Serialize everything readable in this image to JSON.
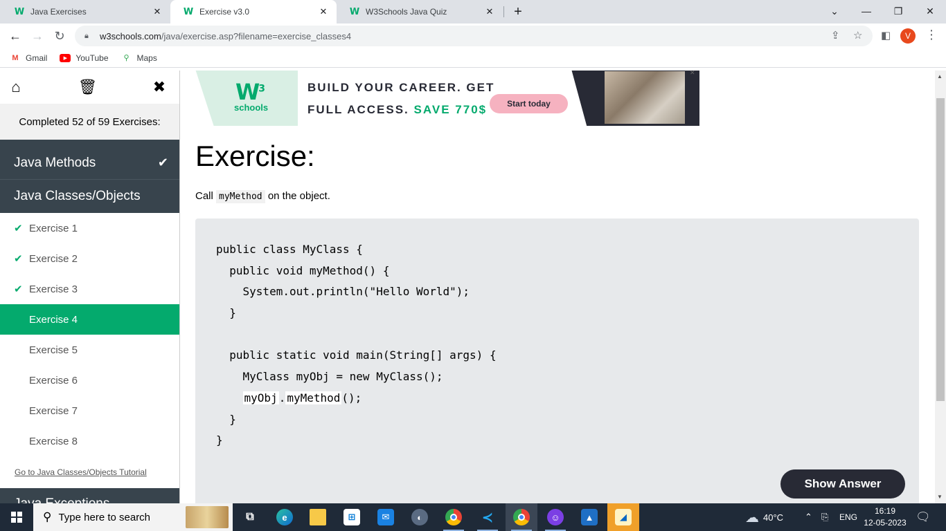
{
  "browser": {
    "tabs": [
      {
        "label": "Java Exercises",
        "favicon": "W",
        "active": false
      },
      {
        "label": "Exercise v3.0",
        "favicon": "W",
        "active": true
      },
      {
        "label": "W3Schools Java Quiz",
        "favicon": "W",
        "active": false
      }
    ],
    "url_host": "w3schools.com",
    "url_path": "/java/exercise.asp?filename=exercise_classes4",
    "profile_initial": "V",
    "bookmarks": [
      {
        "label": "Gmail",
        "icon": "gmail-icon"
      },
      {
        "label": "YouTube",
        "icon": "youtube-icon"
      },
      {
        "label": "Maps",
        "icon": "maps-icon"
      }
    ]
  },
  "sidebar": {
    "progress_text": "Completed 52 of 59 Exercises:",
    "sections": {
      "methods": {
        "label": "Java Methods",
        "completed": true
      },
      "classes": {
        "label": "Java Classes/Objects"
      },
      "exceptions": {
        "label": "Java Exceptions"
      }
    },
    "exercises": [
      {
        "label": "Exercise 1",
        "done": true
      },
      {
        "label": "Exercise 2",
        "done": true
      },
      {
        "label": "Exercise 3",
        "done": true
      },
      {
        "label": "Exercise 4",
        "done": false,
        "active": true
      },
      {
        "label": "Exercise 5",
        "done": false
      },
      {
        "label": "Exercise 6",
        "done": false
      },
      {
        "label": "Exercise 7",
        "done": false
      },
      {
        "label": "Exercise 8",
        "done": false
      }
    ],
    "tutorial_link": "Go to Java Classes/Objects Tutorial"
  },
  "ad": {
    "logo_mark": "W",
    "logo_sup": "3",
    "logo_text": "schools",
    "line1": "BUILD YOUR CAREER. GET",
    "line2_prefix": "FULL ACCESS.",
    "line2_save": "SAVE 770$",
    "cta": "Start today"
  },
  "exercise": {
    "heading": "Exercise:",
    "instr_before": "Call",
    "instr_code": "myMethod",
    "instr_after": "on the object.",
    "code": {
      "l1": "public class MyClass {",
      "l2": "  public void myMethod() {",
      "l3": "    System.out.println(\"Hello World\");",
      "l4": "  }",
      "l5": "",
      "l6": "  public static void main(String[] args) {",
      "l7": "    MyClass myObj = new MyClass();",
      "l8_indent": "    ",
      "l8_blank1": "myObj",
      "l8_dot": ".",
      "l8_blank2": "myMethod",
      "l8_end": "();",
      "l9": "  }",
      "l10": "}"
    },
    "show_answer": "Show Answer"
  },
  "taskbar": {
    "search_placeholder": "Type here to search",
    "weather": "40°C",
    "lang": "ENG",
    "time": "16:19",
    "date": "12-05-2023"
  },
  "colors": {
    "accent": "#04aa6d",
    "sidebar_header": "#38444d",
    "code_bg": "#e7e9eb",
    "button_dark": "#282a35"
  }
}
